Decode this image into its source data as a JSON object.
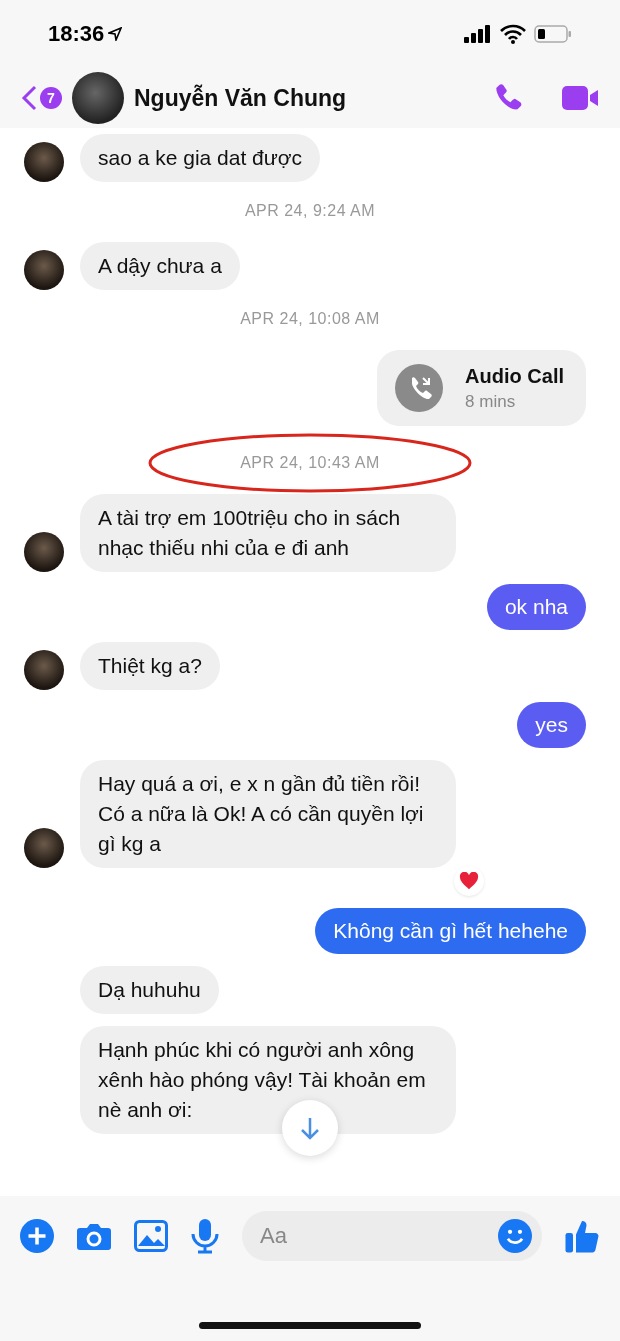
{
  "status_bar": {
    "time": "18:36"
  },
  "header": {
    "back_badge": "7",
    "contact_name": "Nguyễn Văn Chung"
  },
  "messages": [
    {
      "kind": "received",
      "text": "sao a ke gia dat được",
      "show_avatar": true,
      "reacted": false
    },
    {
      "kind": "timestamp",
      "text": "APR 24, 9:24 AM",
      "highlighted": false
    },
    {
      "kind": "received",
      "text": "A dậy chưa a",
      "show_avatar": true,
      "reacted": false
    },
    {
      "kind": "timestamp",
      "text": "APR 24, 10:08 AM",
      "highlighted": false
    },
    {
      "kind": "call",
      "title": "Audio Call",
      "subtitle": "8 mins"
    },
    {
      "kind": "timestamp",
      "text": "APR 24, 10:43 AM",
      "highlighted": true
    },
    {
      "kind": "received",
      "text": "A tài trợ em 100triệu cho in sách nhạc thiếu nhi của e đi anh",
      "show_avatar": true,
      "reacted": false
    },
    {
      "kind": "sent",
      "text": "ok nha",
      "color": "#5a5cf2"
    },
    {
      "kind": "received",
      "text": "Thiệt kg a?",
      "show_avatar": true,
      "reacted": false
    },
    {
      "kind": "sent",
      "text": "yes",
      "color": "#5a5cf2"
    },
    {
      "kind": "received",
      "text": "Hay quá a ơi, e x n gần đủ tiền rồi! Có a nữa là Ok! A có cần quyền lợi gì kg a",
      "show_avatar": true,
      "reacted": true
    },
    {
      "kind": "sent",
      "text": "Không cần gì hết hehehe",
      "color": "#2d6cf0"
    },
    {
      "kind": "received",
      "text": "Dạ huhuhu",
      "show_avatar": false,
      "reacted": false
    },
    {
      "kind": "received",
      "text": "Hạnh phúc khi có người anh xông xênh hào phóng vậy! Tài khoản em nè anh ơi:",
      "show_avatar": false,
      "reacted": false
    }
  ],
  "composer": {
    "placeholder": "Aa"
  }
}
